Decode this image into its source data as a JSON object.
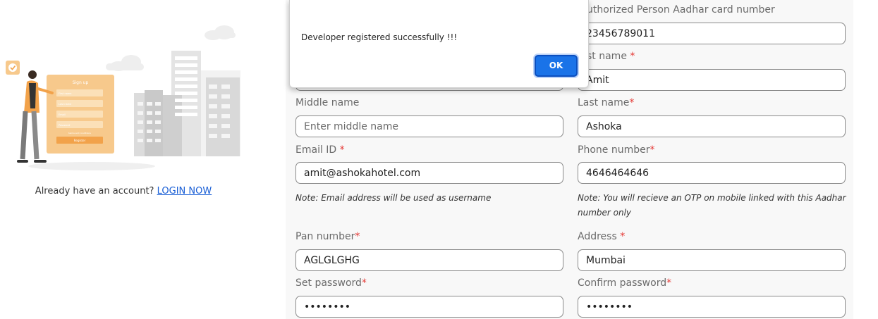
{
  "left": {
    "signup_card": {
      "title": "Sign up",
      "fields": [
        "First name",
        "Last name",
        "Email",
        "Password"
      ],
      "small_text": "terms and conditions",
      "button": "Register"
    },
    "already_text": "Already have an account?",
    "login_link": "LOGIN NOW"
  },
  "form": {
    "aadhar": {
      "label": "uthorized Person Aadhar card number",
      "value": "23456789011"
    },
    "first_name": {
      "label": "st name",
      "required": "*",
      "value": "Amit"
    },
    "middle_name": {
      "label": "Middle name",
      "placeholder": "Enter middle name",
      "value": ""
    },
    "last_name": {
      "label": "Last name",
      "required": "*",
      "value": "Ashoka"
    },
    "email": {
      "label": "Email ID",
      "required": "*",
      "value": "amit@ashokahotel.com",
      "note": "Note: Email address will be used as username"
    },
    "phone": {
      "label": "Phone number",
      "required": "*",
      "value": "4646464646",
      "note_line1": "Note: You will recieve an OTP on mobile linked with this Aadhar",
      "note_line2": "number only"
    },
    "pan": {
      "label": "Pan number",
      "required": "*",
      "value": "AGLGLGHG"
    },
    "address": {
      "label": "Address",
      "required": "*",
      "value": "Mumbai"
    },
    "password": {
      "label": "Set password",
      "required": "*",
      "value": "••••••••"
    },
    "confirm_password": {
      "label": "Confirm password",
      "required": "*",
      "value": "••••••••"
    }
  },
  "alert": {
    "message": "Developer registered successfully !!!",
    "ok_label": "OK"
  },
  "colors": {
    "accent": "#1a73e8",
    "required": "#e53935",
    "link": "#1a5fd6",
    "illustration_orange": "#f7c98c"
  }
}
